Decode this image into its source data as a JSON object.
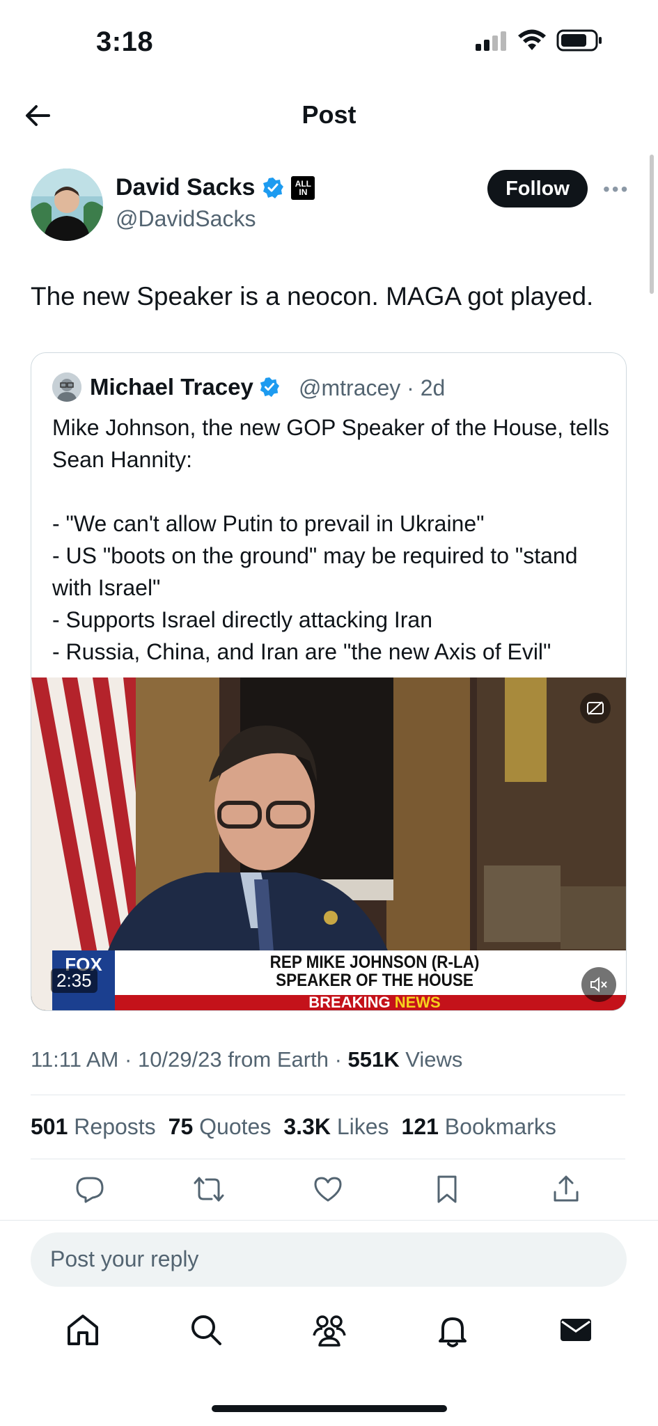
{
  "status_bar": {
    "time": "3:18"
  },
  "header": {
    "title": "Post"
  },
  "author": {
    "name": "David Sacks",
    "handle": "@DavidSacks",
    "badge_text": "ALL IN",
    "follow_label": "Follow"
  },
  "post": {
    "text": "The new Speaker is a neocon. MAGA got played."
  },
  "quote": {
    "name": "Michael Tracey",
    "handle": "@mtracey",
    "age": "2d",
    "text": "Mike Johnson, the new GOP Speaker of the House, tells Sean Hannity:\n\n- \"We can't allow Putin to prevail in Ukraine\"\n- US \"boots on the ground\" may be required to \"stand with Israel\"\n- Supports Israel directly attacking Iran\n- Russia, China, and Iran are \"the new Axis of Evil\"",
    "video": {
      "duration": "2:35",
      "chyron_line1": "REP MIKE JOHNSON (R-LA)",
      "chyron_line2": "SPEAKER OF THE HOUSE",
      "breaking_1": "BREAKING",
      "breaking_2": "NEWS",
      "network": "FOX"
    }
  },
  "meta": {
    "time": "11:11 AM",
    "date": "10/29/23",
    "source": "from Earth",
    "views_count": "551K",
    "views_label": "Views"
  },
  "stats": [
    {
      "count": "501",
      "label": "Reposts"
    },
    {
      "count": "75",
      "label": "Quotes"
    },
    {
      "count": "3.3K",
      "label": "Likes"
    },
    {
      "count": "121",
      "label": "Bookmarks"
    }
  ],
  "reply": {
    "placeholder": "Post your reply"
  },
  "icons": {
    "actions": [
      "reply-icon",
      "repost-icon",
      "like-icon",
      "bookmark-icon",
      "share-icon"
    ],
    "nav": [
      "home-icon",
      "search-icon",
      "communities-icon",
      "notifications-icon",
      "messages-icon"
    ]
  },
  "colors": {
    "verified": "#1d9bf0",
    "text": "#0f1419",
    "secondary": "#536471"
  }
}
